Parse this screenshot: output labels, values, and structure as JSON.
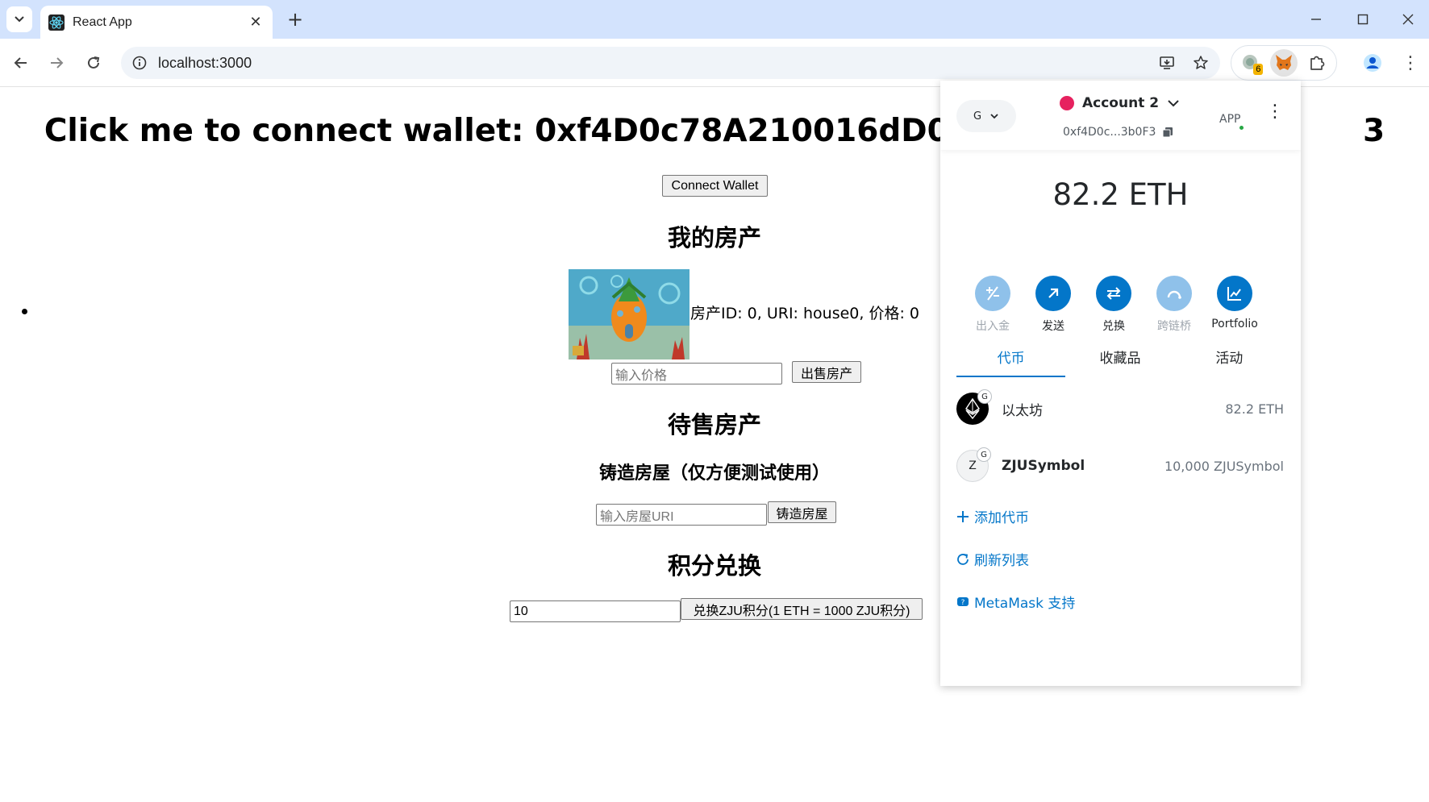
{
  "browser": {
    "tab_title": "React App",
    "url": "localhost:3000",
    "extension_badge": "6"
  },
  "page": {
    "heading": "Click me to connect wallet: 0xf4D0c78A210016dD02f4",
    "heading_tail": "3",
    "connect_button": "Connect Wallet",
    "my_property_title": "我的房产",
    "property_info": "房产ID: 0, URI: house0, 价格: 0",
    "price_placeholder": "输入价格",
    "sell_button": "出售房产",
    "for_sale_title": "待售房产",
    "mint_title": "铸造房屋（仅方便测试使用）",
    "uri_placeholder": "输入房屋URI",
    "mint_button": "铸造房屋",
    "exchange_title": "积分兑换",
    "exchange_value": "10",
    "exchange_button": "兑换ZJU积分(1 ETH = 1000 ZJU积分)"
  },
  "metamask": {
    "network_label": "G",
    "account_name": "Account 2",
    "address": "0xf4D0c...3b0F3",
    "app_label": "APP",
    "balance": "82.2 ETH",
    "actions": [
      {
        "label": "出入金",
        "enabled": false
      },
      {
        "label": "发送",
        "enabled": true
      },
      {
        "label": "兑换",
        "enabled": true
      },
      {
        "label": "跨链桥",
        "enabled": false
      },
      {
        "label": "Portfolio",
        "enabled": true
      }
    ],
    "tabs": [
      "代币",
      "收藏品",
      "活动"
    ],
    "active_tab": 0,
    "tokens": [
      {
        "name": "以太坊",
        "balance": "82.2 ETH",
        "icon": "ethereum-icon",
        "badge": "G"
      },
      {
        "name": "ZJUSymbol",
        "balance": "10,000 ZJUSymbol",
        "icon_letter": "Z",
        "badge": "G"
      }
    ],
    "add_token": "添加代币",
    "refresh_list": "刷新列表",
    "support": "MetaMask 支持"
  },
  "colors": {
    "chrome_tabstrip": "#d3e3fd",
    "metamask_blue": "#0376c9",
    "account_dot": "#e6215f"
  }
}
